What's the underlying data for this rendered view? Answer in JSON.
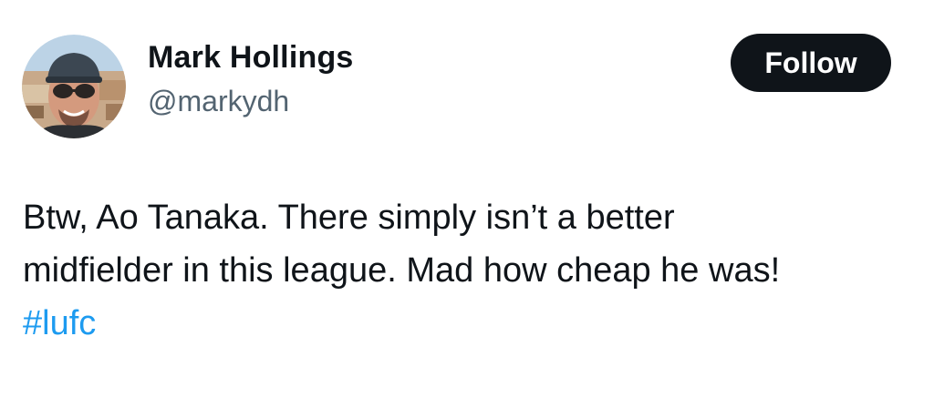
{
  "author": {
    "display_name": "Mark Hollings",
    "handle": "@markydh",
    "avatar_icon": "profile-photo"
  },
  "actions": {
    "follow_label": "Follow"
  },
  "tweet": {
    "lines": [
      "Btw, Ao Tanaka. There simply isn’t a better",
      "midfielder in this league. Mad how cheap he was!"
    ],
    "hashtag": "#lufc"
  },
  "colors": {
    "text": "#0f1419",
    "secondary_text": "#536471",
    "link": "#1d9bf0",
    "button_bg": "#0f1419",
    "button_text": "#ffffff"
  }
}
